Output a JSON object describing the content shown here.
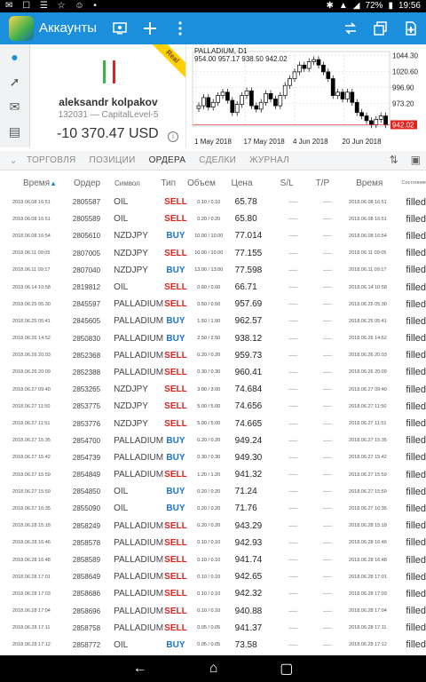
{
  "status_bar": {
    "left_icons": "✉ ☐ ☰ ☆ ☺ •",
    "battery": "72%",
    "time": "19:56"
  },
  "app_bar": {
    "title": "Аккаунты",
    "icons": [
      "account-settings-icon",
      "add-icon",
      "more-icon",
      "trading-icon",
      "copy-window-icon",
      "add-document-icon"
    ]
  },
  "account": {
    "ribbon": "Real",
    "name": "aleksandr kolpakov",
    "sub": "132031 — CapitalLevel-5",
    "balance": "-10 370.47 USD"
  },
  "chart": {
    "title": "PALLADIUM, D1",
    "ohlc": "954.00  957.17  938.50  942.02",
    "current_label": "942.02",
    "chart_data": {
      "type": "candlestick",
      "symbol": "PALLADIUM",
      "timeframe": "D1",
      "ohlc_last": [
        954.0,
        957.17,
        938.5,
        942.02
      ],
      "y_ticks": [
        "1044.30",
        "1020.60",
        "996.90",
        "973.20"
      ],
      "x_ticks": [
        "1 May 2018",
        "17 May 2018",
        "4 Jun 2018",
        "20 Jun 2018"
      ],
      "ylim": [
        940,
        1050
      ],
      "closes": [
        970,
        982,
        968,
        975,
        985,
        990,
        978,
        960,
        972,
        985,
        992,
        970,
        965,
        975,
        988,
        980,
        970,
        985,
        1000,
        1010,
        1020,
        1030,
        1025,
        1035,
        1038,
        1030,
        1020,
        1010,
        985,
        990,
        980,
        990,
        975,
        960,
        955,
        948,
        942,
        950,
        955,
        942
      ]
    }
  },
  "tabs": {
    "items": [
      "ТОРГОВЛЯ",
      "ПОЗИЦИИ",
      "ОРДЕРА",
      "СДЕЛКИ",
      "ЖУРНАЛ"
    ],
    "active": 2
  },
  "table": {
    "headers": [
      "Время",
      "Ордер",
      "Символ",
      "Тип",
      "Объем",
      "Цена",
      "S/L",
      "T/P",
      "Время",
      "Состояние"
    ],
    "rows": [
      [
        "2018.06.08 16:51",
        "2805587",
        "OIL",
        "SELL",
        "0.10 / 0.10",
        "65.78",
        "—",
        "—",
        "2018.06.08 16:51",
        "filled"
      ],
      [
        "2018.06.08 16:51",
        "2805589",
        "OIL",
        "SELL",
        "0.20 / 0.20",
        "65.80",
        "—",
        "—",
        "2018.06.08 16:51",
        "filled"
      ],
      [
        "2018.06.08 16:54",
        "2805610",
        "NZDJPY",
        "BUY",
        "10.00 / 10.00",
        "77.014",
        "—",
        "—",
        "2018.06.08 16:54",
        "filled"
      ],
      [
        "2018.06.11 09:05",
        "2807005",
        "NZDJPY",
        "SELL",
        "10.00 / 10.00",
        "77.155",
        "—",
        "—",
        "2018.06.11 09:05",
        "filled"
      ],
      [
        "2018.06.11 09:17",
        "2807040",
        "NZDJPY",
        "BUY",
        "13.00 / 13.00",
        "77.598",
        "—",
        "—",
        "2018.06.11 09:17",
        "filled"
      ],
      [
        "2018.06.14 10:58",
        "2819812",
        "OIL",
        "SELL",
        "0.60 / 0.60",
        "66.71",
        "—",
        "—",
        "2018.06.14 10:58",
        "filled"
      ],
      [
        "2018.06.25 05:30",
        "2845597",
        "PALLADIUM",
        "SELL",
        "0.50 / 0.50",
        "957.69",
        "—",
        "—",
        "2018.06.25 05:30",
        "filled"
      ],
      [
        "2018.06.25 05:41",
        "2845605",
        "PALLADIUM",
        "BUY",
        "1.50 / 1.50",
        "962.57",
        "—",
        "—",
        "2018.06.25 05:41",
        "filled"
      ],
      [
        "2018.06.26 14:52",
        "2850830",
        "PALLADIUM",
        "BUY",
        "2.50 / 2.50",
        "938.12",
        "—",
        "—",
        "2018.06.26 14:52",
        "filled"
      ],
      [
        "2018.06.26 20:03",
        "2852368",
        "PALLADIUM",
        "SELL",
        "0.20 / 0.20",
        "959.73",
        "—",
        "—",
        "2018.06.26 20:03",
        "filled"
      ],
      [
        "2018.06.26 20:09",
        "2852388",
        "PALLADIUM",
        "SELL",
        "0.30 / 0.30",
        "960.41",
        "—",
        "—",
        "2018.06.26 20:09",
        "filled"
      ],
      [
        "2018.06.27 09:40",
        "2853265",
        "NZDJPY",
        "SELL",
        "3.00 / 3.00",
        "74.684",
        "—",
        "—",
        "2018.06.27 09:40",
        "filled"
      ],
      [
        "2018.06.27 11:50",
        "2853775",
        "NZDJPY",
        "SELL",
        "5.00 / 5.00",
        "74.656",
        "—",
        "—",
        "2018.06.27 11:50",
        "filled"
      ],
      [
        "2018.06.27 11:51",
        "2853776",
        "NZDJPY",
        "SELL",
        "5.00 / 5.00",
        "74.665",
        "—",
        "—",
        "2018.06.27 11:51",
        "filled"
      ],
      [
        "2018.06.27 15:35",
        "2854700",
        "PALLADIUM",
        "BUY",
        "0.20 / 0.20",
        "949.24",
        "—",
        "—",
        "2018.06.27 15:35",
        "filled"
      ],
      [
        "2018.06.27 15:42",
        "2854739",
        "PALLADIUM",
        "BUY",
        "0.30 / 0.30",
        "949.30",
        "—",
        "—",
        "2018.06.27 15:42",
        "filled"
      ],
      [
        "2018.06.27 15:59",
        "2854849",
        "PALLADIUM",
        "SELL",
        "1.20 / 1.20",
        "941.32",
        "—",
        "—",
        "2018.06.27 15:59",
        "filled"
      ],
      [
        "2018.06.27 15:59",
        "2854850",
        "OIL",
        "BUY",
        "0.20 / 0.20",
        "71.24",
        "—",
        "—",
        "2018.06.27 15:59",
        "filled"
      ],
      [
        "2018.06.27 16:35",
        "2855090",
        "OIL",
        "BUY",
        "0.20 / 0.20",
        "71.76",
        "—",
        "—",
        "2018.06.27 16:35",
        "filled"
      ],
      [
        "2018.06.28 15:18",
        "2858249",
        "PALLADIUM",
        "SELL",
        "0.20 / 0.20",
        "943.29",
        "—",
        "—",
        "2018.06.28 15:18",
        "filled"
      ],
      [
        "2018.06.28 16:46",
        "2858578",
        "PALLADIUM",
        "SELL",
        "0.10 / 0.10",
        "942.93",
        "—",
        "—",
        "2018.06.28 16:46",
        "filled"
      ],
      [
        "2018.06.28 16:48",
        "2858589",
        "PALLADIUM",
        "SELL",
        "0.10 / 0.10",
        "941.74",
        "—",
        "—",
        "2018.06.28 16:48",
        "filled"
      ],
      [
        "2018.06.28 17:01",
        "2858649",
        "PALLADIUM",
        "SELL",
        "0.10 / 0.10",
        "942.65",
        "—",
        "—",
        "2018.06.28 17:01",
        "filled"
      ],
      [
        "2018.06.28 17:03",
        "2858686",
        "PALLADIUM",
        "SELL",
        "0.10 / 0.10",
        "942.32",
        "—",
        "—",
        "2018.06.28 17:03",
        "filled"
      ],
      [
        "2018.06.28 17:04",
        "2858696",
        "PALLADIUM",
        "SELL",
        "0.10 / 0.10",
        "940.88",
        "—",
        "—",
        "2018.06.28 17:04",
        "filled"
      ],
      [
        "2018.06.28 17:11",
        "2858758",
        "PALLADIUM",
        "SELL",
        "0.05 / 0.05",
        "941.37",
        "—",
        "—",
        "2018.06.28 17:11",
        "filled"
      ],
      [
        "2018.06.28 17:12",
        "2858772",
        "OIL",
        "BUY",
        "0.05 / 0.05",
        "73.58",
        "—",
        "—",
        "2018.06.28 17:12",
        "filled"
      ]
    ]
  },
  "colors": {
    "accent": "#1b8edc",
    "sell": "#e0231f",
    "buy": "#1b74c9"
  }
}
